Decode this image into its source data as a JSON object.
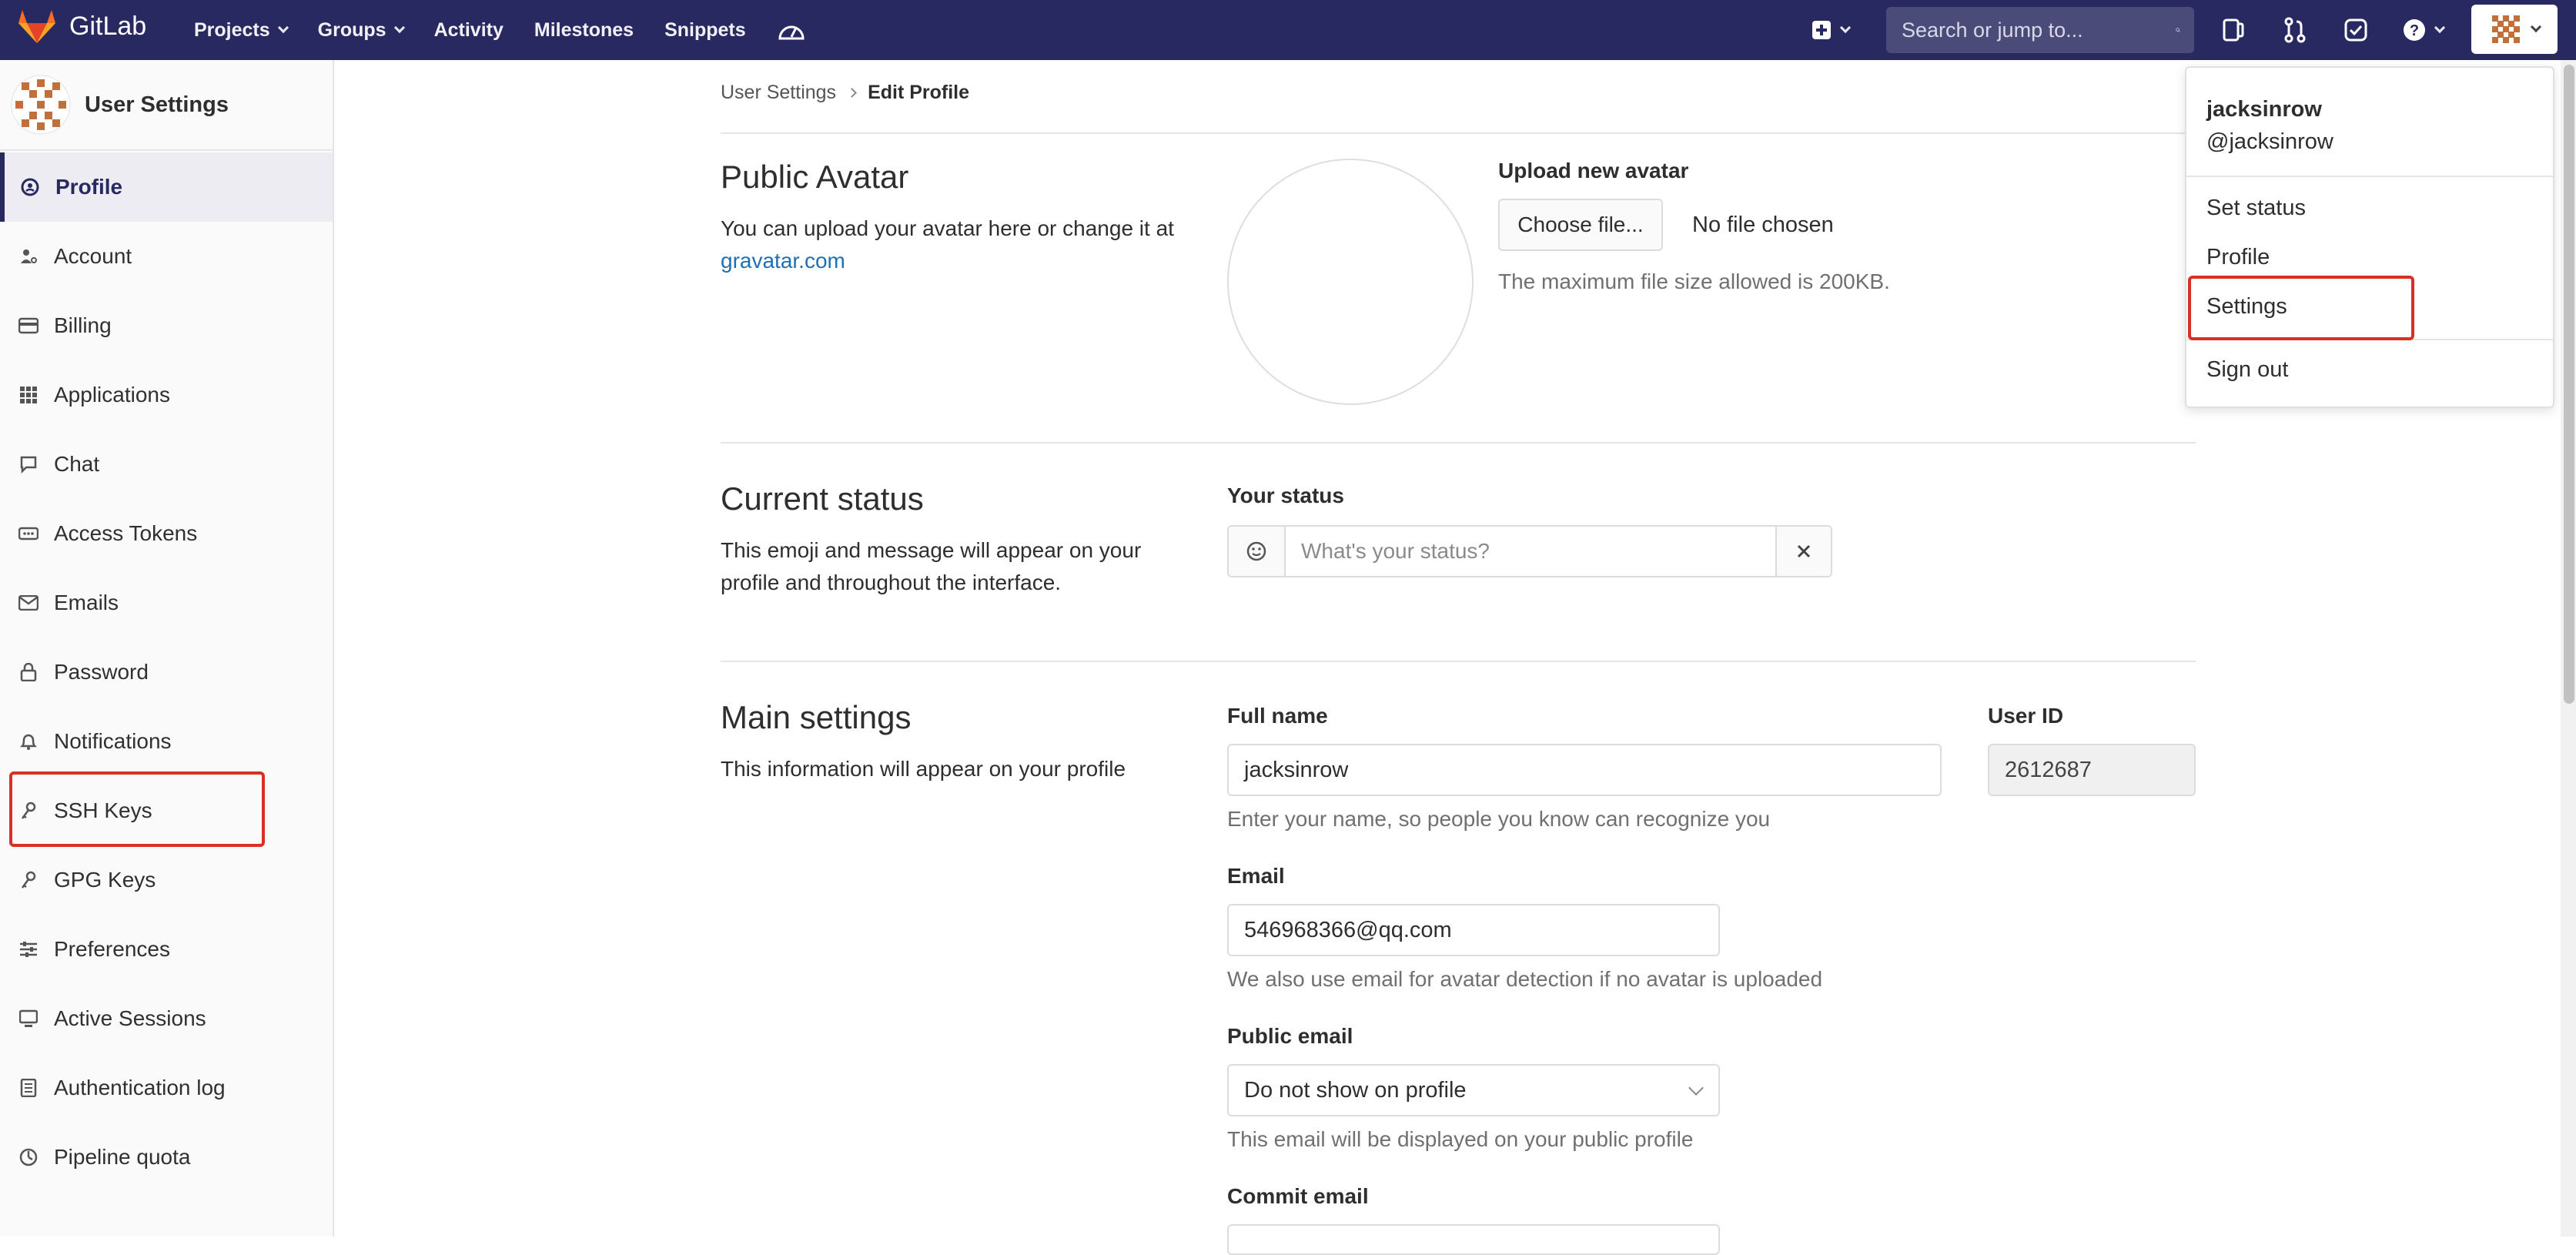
{
  "navbar": {
    "brand": "GitLab",
    "links": [
      {
        "label": "Projects",
        "has_caret": true
      },
      {
        "label": "Groups",
        "has_caret": true
      },
      {
        "label": "Activity",
        "has_caret": false
      },
      {
        "label": "Milestones",
        "has_caret": false
      },
      {
        "label": "Snippets",
        "has_caret": false
      }
    ],
    "search_placeholder": "Search or jump to...",
    "colors": {
      "background": "#292961",
      "accent": "#fc6d26"
    }
  },
  "sidebar": {
    "title": "User Settings",
    "items": [
      {
        "label": "Profile",
        "icon": "profile-icon",
        "active": true
      },
      {
        "label": "Account",
        "icon": "account-icon"
      },
      {
        "label": "Billing",
        "icon": "credit-card-icon"
      },
      {
        "label": "Applications",
        "icon": "applications-icon"
      },
      {
        "label": "Chat",
        "icon": "comment-icon"
      },
      {
        "label": "Access Tokens",
        "icon": "token-icon"
      },
      {
        "label": "Emails",
        "icon": "mail-icon"
      },
      {
        "label": "Password",
        "icon": "lock-icon"
      },
      {
        "label": "Notifications",
        "icon": "bell-icon"
      },
      {
        "label": "SSH Keys",
        "icon": "key-icon",
        "highlighted": true
      },
      {
        "label": "GPG Keys",
        "icon": "key-icon"
      },
      {
        "label": "Preferences",
        "icon": "sliders-icon"
      },
      {
        "label": "Active Sessions",
        "icon": "monitor-icon"
      },
      {
        "label": "Authentication log",
        "icon": "log-icon"
      },
      {
        "label": "Pipeline quota",
        "icon": "pipeline-icon"
      }
    ]
  },
  "breadcrumb": {
    "parent": "User Settings",
    "current": "Edit Profile"
  },
  "avatar_section": {
    "title": "Public Avatar",
    "desc_prefix": "You can upload your avatar here or change it at ",
    "desc_link": "gravatar.com",
    "upload_label": "Upload new avatar",
    "choose_button": "Choose file...",
    "no_file": "No file chosen",
    "max_size_note": "The maximum file size allowed is 200KB."
  },
  "status_section": {
    "title": "Current status",
    "desc": "This emoji and message will appear on your profile and throughout the interface.",
    "your_status_label": "Your status",
    "status_placeholder": "What's your status?"
  },
  "main_settings": {
    "title": "Main settings",
    "desc": "This information will appear on your profile",
    "full_name_label": "Full name",
    "full_name_value": "jacksinrow",
    "full_name_help": "Enter your name, so people you know can recognize you",
    "user_id_label": "User ID",
    "user_id_value": "2612687",
    "email_label": "Email",
    "email_value": "546968366@qq.com",
    "email_help": "We also use email for avatar detection if no avatar is uploaded",
    "public_email_label": "Public email",
    "public_email_value": "Do not show on profile",
    "public_email_help": "This email will be displayed on your public profile",
    "commit_email_label": "Commit email"
  },
  "user_dropdown": {
    "name": "jacksinrow",
    "handle": "@jacksinrow",
    "items": [
      "Set status",
      "Profile",
      "Settings",
      "Sign out"
    ],
    "highlighted_item": "Settings"
  }
}
